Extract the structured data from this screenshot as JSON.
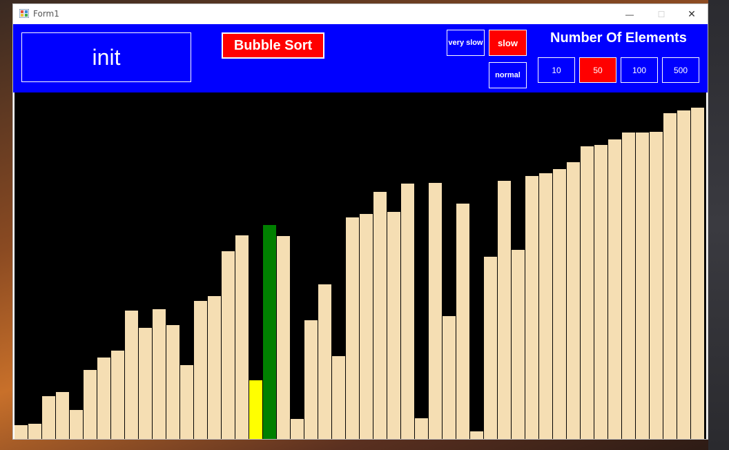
{
  "window": {
    "title": "Form1",
    "minimize_glyph": "—",
    "maximize_glyph": "☐",
    "close_glyph": "✕"
  },
  "header": {
    "status_text": "init",
    "sort_button_label": "Bubble Sort",
    "speed": {
      "very_slow_label": "very slow",
      "slow_label": "slow",
      "normal_label": "normal",
      "selected": "slow"
    },
    "number_of_elements": {
      "title": "Number Of Elements",
      "options": [
        "10",
        "50",
        "100",
        "500"
      ],
      "selected": "50"
    }
  },
  "colors": {
    "header_bg": "#0000ff",
    "selected_button": "#ff0000",
    "canvas_bg": "#000000",
    "bar_default": "#f5deb3",
    "bar_compare": "#ffff00",
    "bar_current": "#008000"
  },
  "bars": {
    "max_value": 500,
    "values": [
      20,
      22,
      62,
      68,
      42,
      100,
      118,
      127,
      185,
      160,
      187,
      164,
      107,
      199,
      206,
      271,
      294,
      85,
      309,
      293,
      29,
      171,
      223,
      120,
      320,
      325,
      357,
      328,
      369,
      30,
      370,
      177,
      340,
      11,
      263,
      373,
      273,
      379,
      383,
      389,
      399,
      422,
      424,
      432,
      442,
      442,
      443,
      470,
      474,
      478
    ],
    "compare_index": 17,
    "current_index": 18
  }
}
